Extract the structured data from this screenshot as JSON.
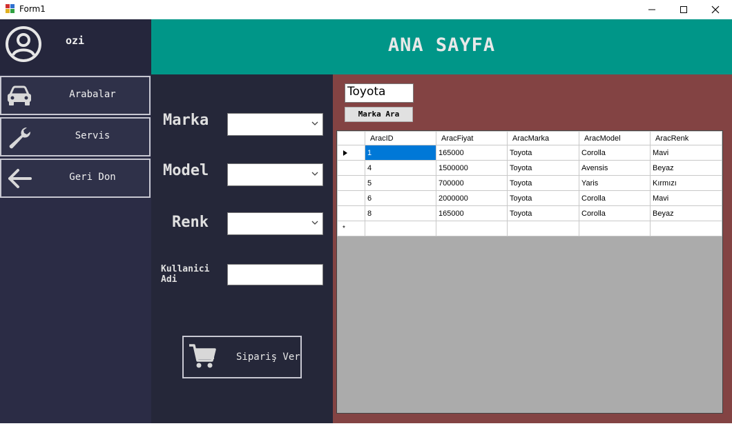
{
  "window": {
    "title": "Form1"
  },
  "user": {
    "name": "ozi"
  },
  "sidebar": {
    "items": [
      {
        "label": "Arabalar",
        "icon": "car-icon"
      },
      {
        "label": "Servis",
        "icon": "wrench-icon"
      },
      {
        "label": "Geri Don",
        "icon": "arrow-left-icon"
      }
    ]
  },
  "header": {
    "title": "ANA SAYFA"
  },
  "form": {
    "marka_label": "Marka",
    "model_label": "Model",
    "renk_label": "Renk",
    "kullanici_label_line1": "Kullanici",
    "kullanici_label_line2": "Adi",
    "marka_value": "",
    "model_value": "",
    "renk_value": "",
    "kullanici_value": "",
    "order_button": "Sipariş Ver"
  },
  "search": {
    "value": "Toyota",
    "button": "Marka Ara"
  },
  "grid": {
    "columns": [
      "AracID",
      "AracFiyat",
      "AracMarka",
      "AracModel",
      "AracRenk"
    ],
    "rows": [
      [
        "1",
        "165000",
        "Toyota",
        "Corolla",
        "Mavi"
      ],
      [
        "4",
        "1500000",
        "Toyota",
        "Avensis",
        "Beyaz"
      ],
      [
        "5",
        "700000",
        "Toyota",
        "Yaris",
        "Kırmızı"
      ],
      [
        "6",
        "2000000",
        "Toyota",
        "Corolla",
        "Mavi"
      ],
      [
        "8",
        "165000",
        "Toyota",
        "Corolla",
        "Beyaz"
      ]
    ],
    "new_row_marker": "*"
  },
  "colors": {
    "header": "#009688",
    "sidebar": "#2b2c45",
    "form_panel": "#252739",
    "results_panel": "#834343",
    "selection": "#0078d7"
  }
}
